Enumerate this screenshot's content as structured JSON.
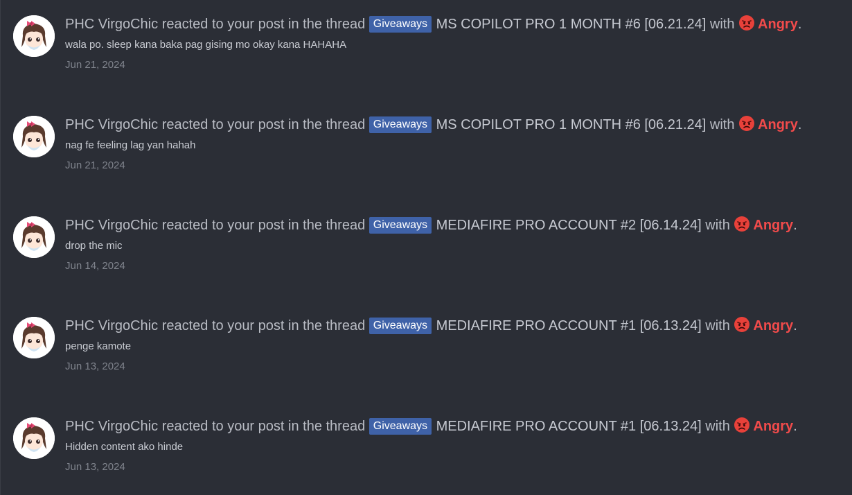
{
  "verb": "reacted to your post in the thread",
  "with_text": "with",
  "period": ".",
  "reaction_emoji": "angry-face-icon",
  "colors": {
    "background": "#2b2e36",
    "badge": "#3f62a8",
    "reaction": "#f24b4b"
  },
  "items": [
    {
      "actor": "PHC VirgoChic",
      "badge": "Giveaways",
      "thread": "MS COPILOT PRO 1 MONTH #6 [06.21.24]",
      "reaction": "Angry",
      "snippet": "wala po. sleep kana baka pag gising mo okay kana HAHAHA",
      "date": "Jun 21, 2024"
    },
    {
      "actor": "PHC VirgoChic",
      "badge": "Giveaways",
      "thread": "MS COPILOT PRO 1 MONTH #6 [06.21.24]",
      "reaction": "Angry",
      "snippet": "nag fe feeling lag yan hahah",
      "date": "Jun 21, 2024"
    },
    {
      "actor": "PHC VirgoChic",
      "badge": "Giveaways",
      "thread": "MEDIAFIRE PRO ACCOUNT #2 [06.14.24]",
      "reaction": "Angry",
      "snippet": "drop the mic",
      "date": "Jun 14, 2024"
    },
    {
      "actor": "PHC VirgoChic",
      "badge": "Giveaways",
      "thread": "MEDIAFIRE PRO ACCOUNT #1 [06.13.24]",
      "reaction": "Angry",
      "snippet": "penge kamote",
      "date": "Jun 13, 2024"
    },
    {
      "actor": "PHC VirgoChic",
      "badge": "Giveaways",
      "thread": "MEDIAFIRE PRO ACCOUNT #1 [06.13.24]",
      "reaction": "Angry",
      "snippet": "Hidden content ako hinde",
      "date": "Jun 13, 2024"
    }
  ]
}
